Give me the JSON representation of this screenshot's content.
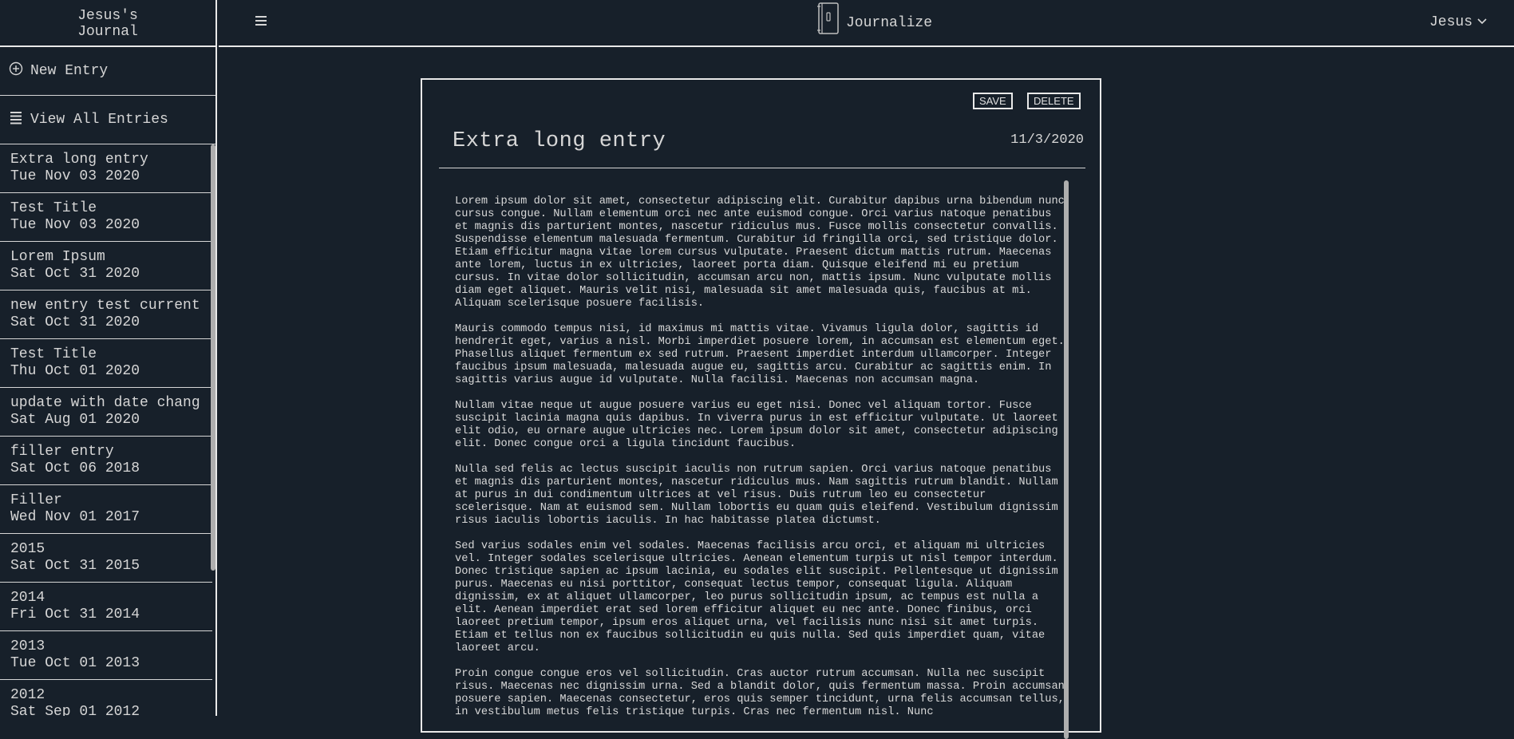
{
  "sidebar": {
    "journal_title": "Jesus's Journal",
    "new_entry_label": "New Entry",
    "view_all_label": "View All Entries",
    "entries": [
      {
        "title": "Extra long entry",
        "date": "Tue Nov 03 2020"
      },
      {
        "title": "Test Title",
        "date": "Tue Nov 03 2020"
      },
      {
        "title": "Lorem Ipsum",
        "date": "Sat Oct 31 2020"
      },
      {
        "title": "new entry test current",
        "date": "Sat Oct 31 2020"
      },
      {
        "title": "Test Title",
        "date": "Thu Oct 01 2020"
      },
      {
        "title": "update with date chang",
        "date": "Sat Aug 01 2020"
      },
      {
        "title": "filler entry",
        "date": "Sat Oct 06 2018"
      },
      {
        "title": "Filler",
        "date": "Wed Nov 01 2017"
      },
      {
        "title": "2015",
        "date": "Sat Oct 31 2015"
      },
      {
        "title": "2014",
        "date": "Fri Oct 31 2014"
      },
      {
        "title": "2013",
        "date": "Tue Oct 01 2013"
      },
      {
        "title": "2012",
        "date": "Sat Sep 01 2012"
      }
    ]
  },
  "header": {
    "brand": "Journalize",
    "user": "Jesus"
  },
  "entry": {
    "save_label": "SAVE",
    "delete_label": "DELETE",
    "title": "Extra long entry",
    "date": "11/3/2020",
    "paragraphs": [
      "Lorem ipsum dolor sit amet, consectetur adipiscing elit. Curabitur dapibus urna bibendum nunc cursus congue. Nullam elementum orci nec ante euismod congue. Orci varius natoque penatibus et magnis dis parturient montes, nascetur ridiculus mus. Fusce mollis consectetur convallis. Suspendisse elementum malesuada fermentum. Curabitur id fringilla orci, sed tristique dolor. Etiam efficitur magna vitae lorem cursus vulputate. Praesent dictum mattis rutrum. Maecenas ante lorem, luctus in ex ultricies, laoreet porta diam. Quisque eleifend mi eu pretium cursus. In vitae dolor sollicitudin, accumsan arcu non, mattis ipsum. Nunc vulputate mollis diam eget aliquet. Mauris velit nisi, malesuada sit amet malesuada quis, faucibus at mi. Aliquam scelerisque posuere facilisis.",
      "Mauris commodo tempus nisi, id maximus mi mattis vitae. Vivamus ligula dolor, sagittis id hendrerit eget, varius a nisl. Morbi imperdiet posuere lorem, in accumsan est elementum eget. Phasellus aliquet fermentum ex sed rutrum. Praesent imperdiet interdum ullamcorper. Integer faucibus ipsum malesuada, malesuada augue eu, sagittis arcu. Curabitur ac sagittis enim. In sagittis varius augue id vulputate. Nulla facilisi. Maecenas non accumsan magna.",
      "Nullam vitae neque ut augue posuere varius eu eget nisi. Donec vel aliquam tortor. Fusce suscipit lacinia magna quis dapibus. In viverra purus in est efficitur vulputate. Ut laoreet elit odio, eu ornare augue ultricies nec. Lorem ipsum dolor sit amet, consectetur adipiscing elit. Donec congue orci a ligula tincidunt faucibus.",
      "Nulla sed felis ac lectus suscipit iaculis non rutrum sapien. Orci varius natoque penatibus et magnis dis parturient montes, nascetur ridiculus mus. Nam sagittis rutrum blandit. Nullam at purus in dui condimentum ultrices at vel risus. Duis rutrum leo eu consectetur scelerisque. Nam at euismod sem. Nullam lobortis eu quam quis eleifend. Vestibulum dignissim risus iaculis lobortis iaculis. In hac habitasse platea dictumst.",
      "Sed varius sodales enim vel sodales. Maecenas facilisis arcu orci, et aliquam mi ultricies vel. Integer sodales scelerisque ultricies. Aenean elementum turpis ut nisl tempor interdum. Donec tristique sapien ac ipsum lacinia, eu sodales elit suscipit. Pellentesque ut dignissim purus. Maecenas eu nisi porttitor, consequat lectus tempor, consequat ligula. Aliquam dignissim, ex at aliquet ullamcorper, leo purus sollicitudin ipsum, ac tempus est nulla a elit. Aenean imperdiet erat sed lorem efficitur aliquet eu nec ante. Donec finibus, orci laoreet pretium tempor, ipsum eros aliquet urna, vel facilisis nunc nisi sit amet turpis. Etiam et tellus non ex faucibus sollicitudin eu quis nulla. Sed quis imperdiet quam, vitae laoreet arcu.",
      "Proin congue congue eros vel sollicitudin. Cras auctor rutrum accumsan. Nulla nec suscipit risus. Maecenas nec dignissim urna. Sed a blandit dolor, quis fermentum massa. Proin accumsan posuere sapien. Maecenas consectetur, eros quis semper tincidunt, urna felis accumsan tellus, in vestibulum metus felis tristique turpis. Cras nec fermentum nisl. Nunc"
    ]
  },
  "icons": {
    "new_entry": "plus-circle-icon",
    "view_all": "list-icon",
    "menu": "hamburger-icon",
    "brand": "journal-icon",
    "user_dropdown": "chevron-down-icon"
  },
  "colors": {
    "background": "#17202a",
    "text": "#d6d6d6",
    "border": "#e9e9e9",
    "scrollbar": "#aeaeae"
  }
}
